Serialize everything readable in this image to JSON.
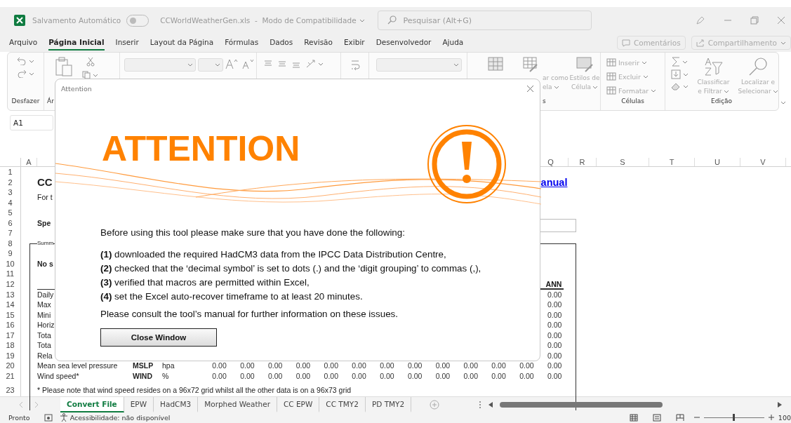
{
  "title_bar": {
    "autosave_label": "Salvamento Automático",
    "autosave_on": false,
    "file_title": "CCWorldWeatherGen.xls  -  Modo de Compatibilidade",
    "search_placeholder": "Pesquisar (Alt+G)"
  },
  "menu": [
    {
      "label": "Arquivo",
      "selected": false
    },
    {
      "label": "Página Inicial",
      "selected": true
    },
    {
      "label": "Inserir",
      "selected": false
    },
    {
      "label": "Layout da Página",
      "selected": false
    },
    {
      "label": "Fórmulas",
      "selected": false
    },
    {
      "label": "Dados",
      "selected": false
    },
    {
      "label": "Revisão",
      "selected": false
    },
    {
      "label": "Exibir",
      "selected": false
    },
    {
      "label": "Desenvolvedor",
      "selected": false
    },
    {
      "label": "Ajuda",
      "selected": false
    }
  ],
  "menu_buttons": [
    "Comentários",
    "Compartilhamento"
  ],
  "ribbon": {
    "undo_label": "Desfazer",
    "clipboard_label": "Ár",
    "styles": [
      {
        "line1": "ar como",
        "line2": "ela"
      },
      {
        "line1": "Estilos de",
        "line2": "Célula"
      }
    ],
    "styles_label": "s",
    "cells": [
      "Inserir",
      "Excluir",
      "Formatar"
    ],
    "cells_label": "Células",
    "editing": [
      {
        "line1": "Classificar",
        "line2": "e Filtrar"
      },
      {
        "line1": "Localizar e",
        "line2": "Selecionar"
      }
    ],
    "editing_label": "Edição"
  },
  "name_box": "A1",
  "columns_left": [
    "A"
  ],
  "columns_right": [
    "Q",
    "R",
    "S",
    "T",
    "U",
    "V"
  ],
  "rows": [
    {
      "number": "1"
    },
    {
      "number": "2",
      "label": "CC",
      "kind": "title",
      "link": "anual"
    },
    {
      "number": "3",
      "label": "For t",
      "kind": "note"
    },
    {
      "number": "4"
    },
    {
      "number": "5"
    },
    {
      "number": "6",
      "label": "Spe",
      "kind": "bold",
      "input_box": true
    },
    {
      "number": "7"
    },
    {
      "number": "8",
      "label": "Summ",
      "kind": "legend"
    },
    {
      "number": "9"
    },
    {
      "number": "10",
      "label": "No s",
      "kind": "bold"
    },
    {
      "number": "11"
    },
    {
      "number": "12",
      "ann": "ANN",
      "kind": "header"
    },
    {
      "number": "13",
      "label": "Daily",
      "ann": "0.00"
    },
    {
      "number": "14",
      "label": "Max",
      "ann": "0.00"
    },
    {
      "number": "15",
      "label": "Mini",
      "ann": "0.00"
    },
    {
      "number": "16",
      "label": "Horiz",
      "ann": "0.00"
    },
    {
      "number": "17",
      "label": "Tota",
      "ann": "0.00"
    },
    {
      "number": "18",
      "label": "Tota",
      "ann": "0.00"
    },
    {
      "number": "19",
      "label": "Rela",
      "ann": "0.00"
    },
    {
      "number": "20",
      "label": "Mean sea level pressure",
      "code": "MSLP",
      "unit": "hpa",
      "values": [
        "0.00",
        "0.00",
        "0.00",
        "0.00",
        "0.00",
        "0.00",
        "0.00",
        "0.00",
        "0.00",
        "0.00",
        "0.00",
        "0.00",
        "0.00"
      ]
    },
    {
      "number": "21",
      "label": "Wind speed*",
      "code": "WIND",
      "unit": "%",
      "values": [
        "0.00",
        "0.00",
        "0.00",
        "0.00",
        "0.00",
        "0.00",
        "0.00",
        "0.00",
        "0.00",
        "0.00",
        "0.00",
        "0.00",
        "0.00"
      ]
    },
    {
      "kind": "collapsed"
    },
    {
      "number": "23",
      "label": "* Please note that wind speed resides on a 96x72 grid whilst all the other data is on a 96x73 grid",
      "kind": "footnote"
    }
  ],
  "sheet_tabs": [
    {
      "label": "Convert File",
      "selected": true
    },
    {
      "label": "EPW",
      "selected": false
    },
    {
      "label": "HadCM3",
      "selected": false
    },
    {
      "label": "Morphed Weather",
      "selected": false
    },
    {
      "label": "CC EPW",
      "selected": false
    },
    {
      "label": "CC TMY2",
      "selected": false
    },
    {
      "label": "PD TMY2",
      "selected": false
    }
  ],
  "status": {
    "ready": "Pronto",
    "accessibility": "Acessibilidade: não disponível",
    "zoom": {
      "level": 0.5
    },
    "zoom_label": "100"
  },
  "dialog": {
    "title": "Attention",
    "heading": "ATTENTION",
    "intro": "Before using this tool please make sure that you have done the following:",
    "items": [
      "**(1)** downloaded the required HadCM3 data from the IPCC Data Distribution Centre,",
      "**(2)** checked that the ‘decimal symbol’ is set to dots (.) and the ‘digit grouping’ to commas (,),",
      "**(3)** verified that macros are permitted within Excel,",
      "**(4)** set the Excel auto-recover timeframe to at least 20 minutes."
    ],
    "note": "Please consult the tool’s manual for further information on these issues.",
    "button": "Close Window"
  }
}
